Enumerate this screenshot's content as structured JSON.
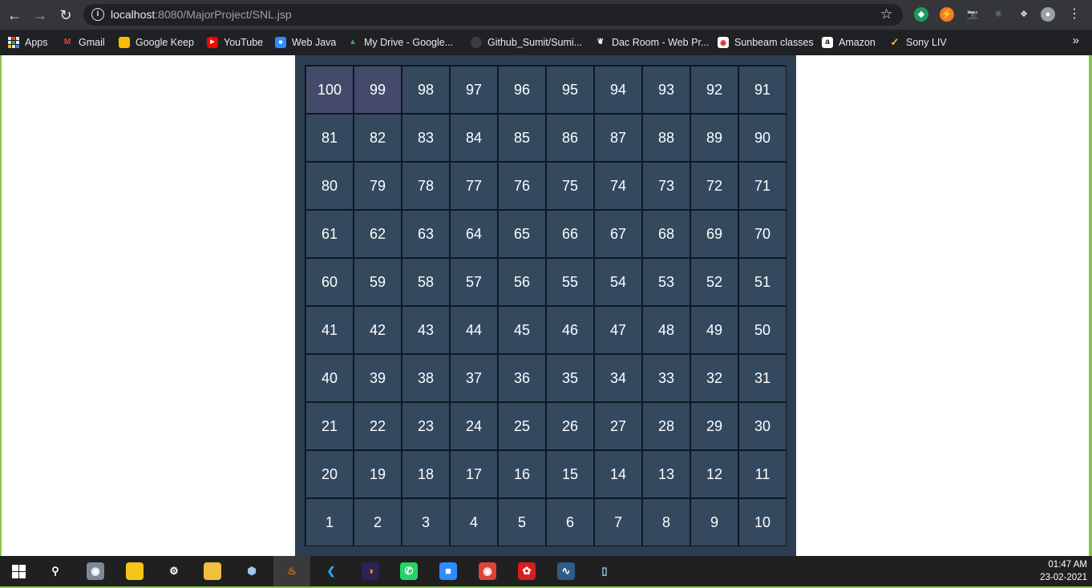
{
  "browser": {
    "url_host": "localhost",
    "url_rest": ":8080/MajorProject/SNL.jsp",
    "back_icon": "arrow-left-icon",
    "forward_icon": "arrow-right-icon",
    "reload_icon": "reload-icon"
  },
  "bookmarks": [
    {
      "label": "Apps",
      "icon": "apps-grid-icon"
    },
    {
      "label": "Gmail",
      "icon": "gmail-icon"
    },
    {
      "label": "Google Keep",
      "icon": "keep-icon"
    },
    {
      "label": "YouTube",
      "icon": "youtube-icon"
    },
    {
      "label": "Web Java",
      "icon": "zoom-icon"
    },
    {
      "label": "My Drive - Google...",
      "icon": "drive-icon"
    },
    {
      "label": "Github_Sumit/Sumi...",
      "icon": "github-icon"
    },
    {
      "label": "Dac Room - Web Pr...",
      "icon": "leaf-icon"
    },
    {
      "label": "Sunbeam classes",
      "icon": "sunbeam-icon"
    },
    {
      "label": "Amazon",
      "icon": "amazon-icon"
    },
    {
      "label": "Sony LIV",
      "icon": "sonyliv-icon"
    }
  ],
  "board": {
    "rows": [
      [
        "100",
        "99",
        "98",
        "97",
        "96",
        "95",
        "94",
        "93",
        "92",
        "91"
      ],
      [
        "81",
        "82",
        "83",
        "84",
        "85",
        "86",
        "87",
        "88",
        "89",
        "90"
      ],
      [
        "80",
        "79",
        "78",
        "77",
        "76",
        "75",
        "74",
        "73",
        "72",
        "71"
      ],
      [
        "61",
        "62",
        "63",
        "64",
        "65",
        "66",
        "67",
        "68",
        "69",
        "70"
      ],
      [
        "60",
        "59",
        "58",
        "57",
        "56",
        "55",
        "54",
        "53",
        "52",
        "51"
      ],
      [
        "41",
        "42",
        "43",
        "44",
        "45",
        "46",
        "47",
        "48",
        "49",
        "50"
      ],
      [
        "40",
        "39",
        "38",
        "37",
        "36",
        "35",
        "34",
        "33",
        "32",
        "31"
      ],
      [
        "21",
        "22",
        "23",
        "24",
        "25",
        "26",
        "27",
        "28",
        "29",
        "30"
      ],
      [
        "20",
        "19",
        "18",
        "17",
        "16",
        "15",
        "14",
        "13",
        "12",
        "11"
      ],
      [
        "1",
        "2",
        "3",
        "4",
        "5",
        "6",
        "7",
        "8",
        "9",
        "10"
      ]
    ],
    "highlighted": [
      "100",
      "99"
    ],
    "cell_color": "#34495e",
    "highlight_color": "#444a6a",
    "frame_color": "#2c3e50"
  },
  "taskbar": {
    "items": [
      "start-icon",
      "search-icon",
      "camera-icon",
      "sticky-notes-icon",
      "settings-icon",
      "file-explorer-icon",
      "box-icon",
      "java-tool-icon",
      "vscode-icon",
      "eclipse-icon",
      "whatsapp-icon",
      "zoom-icon",
      "chrome-icon",
      "acrobat-icon",
      "mysql-workbench-icon",
      "notepad-icon"
    ],
    "time": "01:47 AM",
    "date": "23-02-2021"
  }
}
